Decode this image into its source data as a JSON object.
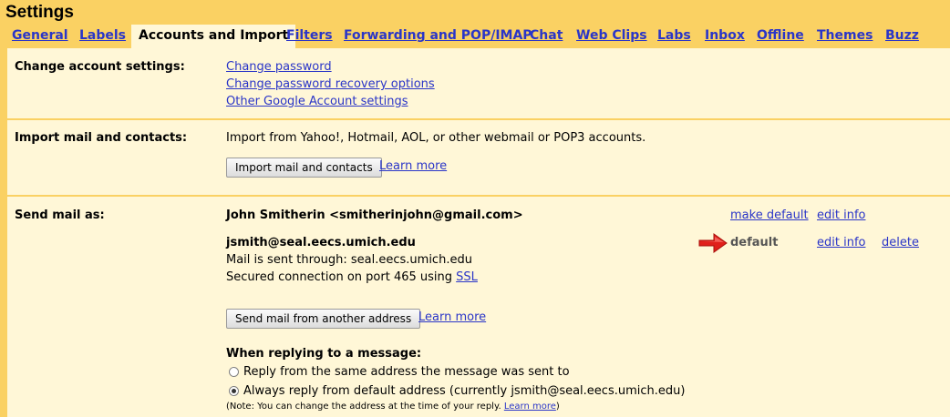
{
  "title": "Settings",
  "tabs": [
    {
      "label": "General"
    },
    {
      "label": "Labels"
    },
    {
      "label": "Accounts and Import",
      "active": true
    },
    {
      "label": "Filters"
    },
    {
      "label": "Forwarding and POP/IMAP"
    },
    {
      "label": "Chat"
    },
    {
      "label": "Web Clips"
    },
    {
      "label": "Labs"
    },
    {
      "label": "Inbox"
    },
    {
      "label": "Offline"
    },
    {
      "label": "Themes"
    },
    {
      "label": "Buzz"
    }
  ],
  "change_account": {
    "label": "Change account settings:",
    "links": [
      "Change password",
      "Change password recovery options",
      "Other Google Account settings"
    ]
  },
  "import": {
    "label": "Import mail and contacts:",
    "description": "Import from Yahoo!, Hotmail, AOL, or other webmail or POP3 accounts.",
    "button": "Import mail and contacts",
    "learn_more": "Learn more"
  },
  "send_as": {
    "label": "Send mail as:",
    "accounts": [
      {
        "name": "John Smitherin <smitherinjohn@gmail.com>",
        "make_default": "make default",
        "edit": "edit info"
      },
      {
        "name": "jsmith@seal.eecs.umich.edu",
        "status": "default",
        "edit": "edit info",
        "delete": "delete",
        "sent_through": "Mail is sent through: seal.eecs.umich.edu",
        "secured_prefix": "Secured connection on port 465 using",
        "secured_link": "SSL"
      }
    ],
    "button": "Send mail from another address",
    "learn_more": "Learn more",
    "reply_heading": "When replying to a message:",
    "reply_options": [
      {
        "label": "Reply from the same address the message was sent to",
        "checked": false
      },
      {
        "label": "Always reply from default address (currently jsmith@seal.eecs.umich.edu)",
        "checked": true
      }
    ],
    "note_prefix": "(Note: You can change the address at the time of your reply.",
    "note_link": "Learn more",
    "note_suffix": ")"
  },
  "colors": {
    "accent_bg": "#fad163",
    "panel_bg": "#fff7d7",
    "link": "#2a35c8",
    "arrow": "#e0201b"
  }
}
